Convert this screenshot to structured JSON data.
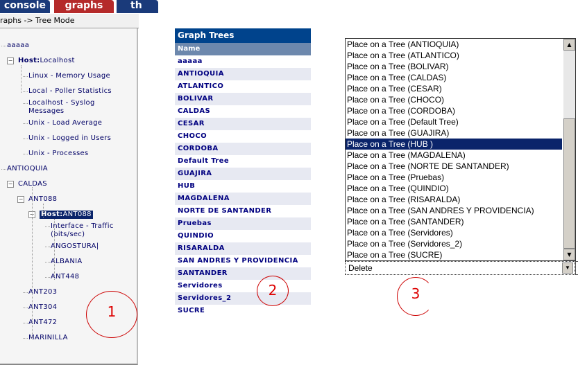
{
  "tabs": [
    {
      "label": "console",
      "color": "#1a3a7a"
    },
    {
      "label": "graphs",
      "color": "#b52a2a"
    },
    {
      "label": "th",
      "color": "#1a3a7a"
    }
  ],
  "breadcrumb": "raphs -> Tree Mode",
  "tree": [
    {
      "label": "aaaaa"
    },
    {
      "prefix": "Host:",
      "label": "Localhost"
    },
    {
      "label": "Linux - Memory Usage"
    },
    {
      "label": "Local - Poller Statistics"
    },
    {
      "label": "Localhost - Syslog Messages"
    },
    {
      "label": "Unix - Load Average"
    },
    {
      "label": "Unix - Logged in Users"
    },
    {
      "label": "Unix - Processes"
    },
    {
      "label": "ANTIOQUIA"
    },
    {
      "label": "CALDAS"
    },
    {
      "label": "ANT088"
    },
    {
      "prefix": "Host:",
      "label": "ANT088",
      "selected": true
    },
    {
      "label": "Interface - Traffic (bits/sec)"
    },
    {
      "label": "ANGOSTURA|"
    },
    {
      "label": "ALBANIA"
    },
    {
      "label": "ANT448"
    },
    {
      "label": "ANT203"
    },
    {
      "label": "ANT304"
    },
    {
      "label": "ANT472"
    },
    {
      "label": "MARINILLA"
    }
  ],
  "graph_trees": {
    "title": "Graph Trees",
    "column": "Name",
    "rows": [
      "aaaaa",
      "ANTIOQUIA",
      "ATLANTICO",
      "BOLIVAR",
      "CALDAS",
      "CESAR",
      "CHOCO",
      "CORDOBA",
      "Default Tree",
      "GUAJIRA",
      "HUB",
      "MAGDALENA",
      "NORTE DE SANTANDER",
      "Pruebas",
      "QUINDIO",
      "RISARALDA",
      "SAN ANDRES Y PROVIDENCIA",
      "SANTANDER",
      "Servidores",
      "Servidores_2",
      "SUCRE"
    ]
  },
  "listbox": {
    "options": [
      "Place on a Tree (ANTIOQUIA)",
      "Place on a Tree (ATLANTICO)",
      "Place on a Tree (BOLIVAR)",
      "Place on a Tree (CALDAS)",
      "Place on a Tree (CESAR)",
      "Place on a Tree (CHOCO)",
      "Place on a Tree (CORDOBA)",
      "Place on a Tree (Default Tree)",
      "Place on a Tree (GUAJIRA)",
      "Place on a Tree (HUB )",
      "Place on a Tree (MAGDALENA)",
      "Place on a Tree (NORTE DE SANTANDER)",
      "Place on a Tree (Pruebas)",
      "Place on a Tree (QUINDIO)",
      "Place on a Tree (RISARALDA)",
      "Place on a Tree (SAN ANDRES Y PROVIDENCIA)",
      "Place on a Tree (SANTANDER)",
      "Place on a Tree (Servidores)",
      "Place on a Tree (Servidores_2)",
      "Place on a Tree (SUCRE)"
    ],
    "selected_index": 9
  },
  "action_select": {
    "value": "Delete"
  },
  "annotations": [
    "1",
    "2",
    "3"
  ]
}
